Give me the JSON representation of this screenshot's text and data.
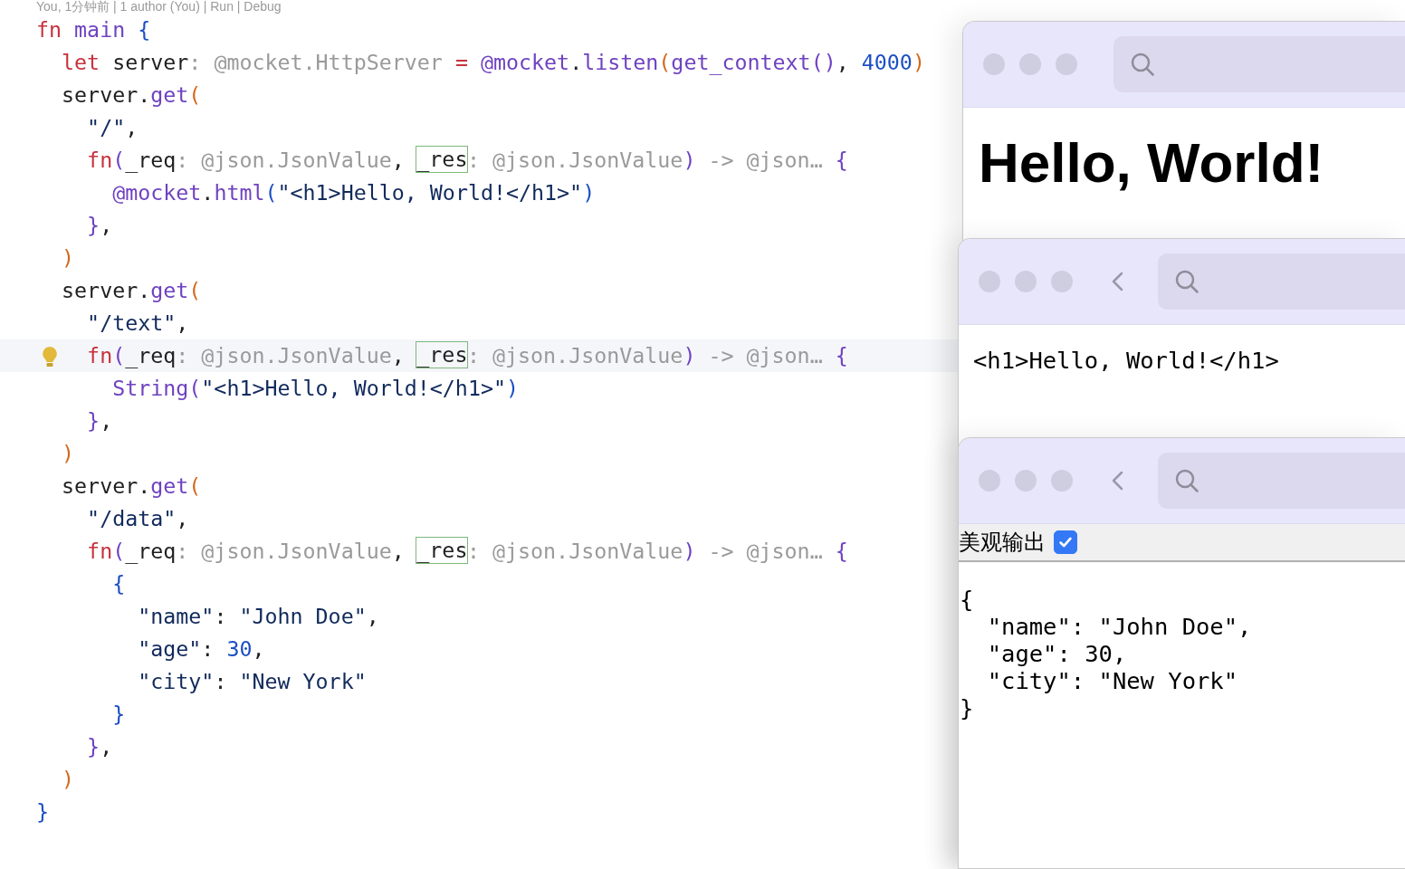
{
  "editor": {
    "codelens": "You, 1分钟前 | 1 author (You) | Run | Debug",
    "lines": [
      {
        "current": false,
        "tokens": [
          {
            "kind": "kw",
            "text": "fn"
          },
          {
            "kind": "fn",
            "text": " main"
          },
          {
            "kind": "brace",
            "text": " {"
          }
        ]
      },
      {
        "current": false,
        "tokens": [
          {
            "kind": "kw",
            "text": "  let"
          },
          {
            "kind": "id",
            "text": " server"
          },
          {
            "kind": "hint",
            "text": ": @mocket.HttpServer"
          },
          {
            "kind": "kw",
            "text": " ="
          },
          {
            "kind": "fn",
            "text": " @mocket"
          },
          {
            "kind": "id",
            "text": "."
          },
          {
            "kind": "fn",
            "text": "listen"
          },
          {
            "kind": "paren",
            "text": "("
          },
          {
            "kind": "fn",
            "text": "get_context()"
          },
          {
            "kind": "id",
            "text": ", "
          },
          {
            "kind": "num",
            "text": "4000"
          },
          {
            "kind": "paren",
            "text": ")"
          }
        ]
      },
      {
        "current": false,
        "tokens": [
          {
            "kind": "id",
            "text": "  server."
          },
          {
            "kind": "fn",
            "text": "get"
          },
          {
            "kind": "paren",
            "text": "("
          }
        ]
      },
      {
        "current": false,
        "tokens": [
          {
            "kind": "str",
            "text": "    \"/\""
          },
          {
            "kind": "id",
            "text": ","
          }
        ]
      },
      {
        "current": false,
        "tokens": [
          {
            "kind": "kw",
            "text": "    fn"
          },
          {
            "kind": "fn",
            "text": "("
          },
          {
            "kind": "id",
            "text": "_req"
          },
          {
            "kind": "hint",
            "text": ": @json.JsonValue"
          },
          {
            "kind": "id",
            "text": ", "
          },
          {
            "kind": "boxed",
            "text": "_res"
          },
          {
            "kind": "hint",
            "text": ": @json.JsonValue"
          },
          {
            "kind": "fn",
            "text": ")"
          },
          {
            "kind": "hint",
            "text": " -> @json…"
          },
          {
            "kind": "fn",
            "text": " {"
          }
        ]
      },
      {
        "current": false,
        "tokens": [
          {
            "kind": "fn",
            "text": "      @mocket"
          },
          {
            "kind": "id",
            "text": "."
          },
          {
            "kind": "fn",
            "text": "html"
          },
          {
            "kind": "brace",
            "text": "("
          },
          {
            "kind": "str",
            "text": "\"<h1>Hello, World!</h1>\""
          },
          {
            "kind": "brace",
            "text": ")"
          }
        ]
      },
      {
        "current": false,
        "tokens": [
          {
            "kind": "fn",
            "text": "    }"
          },
          {
            "kind": "id",
            "text": ","
          }
        ]
      },
      {
        "current": false,
        "tokens": [
          {
            "kind": "paren",
            "text": "  )"
          }
        ]
      },
      {
        "current": false,
        "tokens": [
          {
            "kind": "id",
            "text": "  server."
          },
          {
            "kind": "fn",
            "text": "get"
          },
          {
            "kind": "paren",
            "text": "("
          }
        ]
      },
      {
        "current": false,
        "tokens": [
          {
            "kind": "str",
            "text": "    \"/text\""
          },
          {
            "kind": "id",
            "text": ","
          }
        ]
      },
      {
        "current": true,
        "tokens": [
          {
            "kind": "kw",
            "text": "    fn"
          },
          {
            "kind": "fn",
            "text": "("
          },
          {
            "kind": "id",
            "text": "_req"
          },
          {
            "kind": "hint",
            "text": ": @json.JsonValue"
          },
          {
            "kind": "id",
            "text": ", "
          },
          {
            "kind": "boxed",
            "text": "_res"
          },
          {
            "kind": "hint",
            "text": ": @json.JsonValue"
          },
          {
            "kind": "fn",
            "text": ")"
          },
          {
            "kind": "hint",
            "text": " -> @json…"
          },
          {
            "kind": "fn",
            "text": " {"
          }
        ]
      },
      {
        "current": false,
        "tokens": [
          {
            "kind": "fn",
            "text": "      String"
          },
          {
            "kind": "fn",
            "text": "("
          },
          {
            "kind": "str",
            "text": "\"<h1>Hello, World!</h1>\""
          },
          {
            "kind": "brace",
            "text": ")"
          }
        ]
      },
      {
        "current": false,
        "tokens": [
          {
            "kind": "fn",
            "text": "    }"
          },
          {
            "kind": "id",
            "text": ","
          }
        ]
      },
      {
        "current": false,
        "tokens": [
          {
            "kind": "paren",
            "text": "  )"
          }
        ]
      },
      {
        "current": false,
        "tokens": [
          {
            "kind": "id",
            "text": "  server."
          },
          {
            "kind": "fn",
            "text": "get"
          },
          {
            "kind": "paren",
            "text": "("
          }
        ]
      },
      {
        "current": false,
        "tokens": [
          {
            "kind": "str",
            "text": "    \"/data\""
          },
          {
            "kind": "id",
            "text": ","
          }
        ]
      },
      {
        "current": false,
        "tokens": [
          {
            "kind": "kw",
            "text": "    fn"
          },
          {
            "kind": "fn",
            "text": "("
          },
          {
            "kind": "id",
            "text": "_req"
          },
          {
            "kind": "hint",
            "text": ": @json.JsonValue"
          },
          {
            "kind": "id",
            "text": ", "
          },
          {
            "kind": "boxed",
            "text": "_res"
          },
          {
            "kind": "hint",
            "text": ": @json.JsonValue"
          },
          {
            "kind": "fn",
            "text": ")"
          },
          {
            "kind": "hint",
            "text": " -> @json…"
          },
          {
            "kind": "fn",
            "text": " {"
          }
        ]
      },
      {
        "current": false,
        "tokens": [
          {
            "kind": "brace",
            "text": "      {"
          }
        ]
      },
      {
        "current": false,
        "tokens": [
          {
            "kind": "str",
            "text": "        \"name\""
          },
          {
            "kind": "id",
            "text": ": "
          },
          {
            "kind": "str",
            "text": "\"John Doe\""
          },
          {
            "kind": "id",
            "text": ","
          }
        ]
      },
      {
        "current": false,
        "tokens": [
          {
            "kind": "str",
            "text": "        \"age\""
          },
          {
            "kind": "id",
            "text": ": "
          },
          {
            "kind": "num",
            "text": "30"
          },
          {
            "kind": "id",
            "text": ","
          }
        ]
      },
      {
        "current": false,
        "tokens": [
          {
            "kind": "str",
            "text": "        \"city\""
          },
          {
            "kind": "id",
            "text": ": "
          },
          {
            "kind": "str",
            "text": "\"New York\""
          }
        ]
      },
      {
        "current": false,
        "tokens": [
          {
            "kind": "brace",
            "text": "      }"
          }
        ]
      },
      {
        "current": false,
        "tokens": [
          {
            "kind": "fn",
            "text": "    }"
          },
          {
            "kind": "id",
            "text": ","
          }
        ]
      },
      {
        "current": false,
        "tokens": [
          {
            "kind": "paren",
            "text": "  )"
          }
        ]
      },
      {
        "current": false,
        "tokens": [
          {
            "kind": "brace",
            "text": "}"
          }
        ]
      }
    ]
  },
  "windows": [
    {
      "kind": "heading",
      "back_button": false,
      "text": "Hello, World!"
    },
    {
      "kind": "source",
      "back_button": true,
      "text": "<h1>Hello, World!</h1>"
    },
    {
      "kind": "json",
      "back_button": true,
      "option": {
        "label": "美观输出",
        "checked": true
      },
      "text": "{\n  \"name\": \"John Doe\",\n  \"age\": 30,\n  \"city\": \"New York\"\n}"
    }
  ]
}
